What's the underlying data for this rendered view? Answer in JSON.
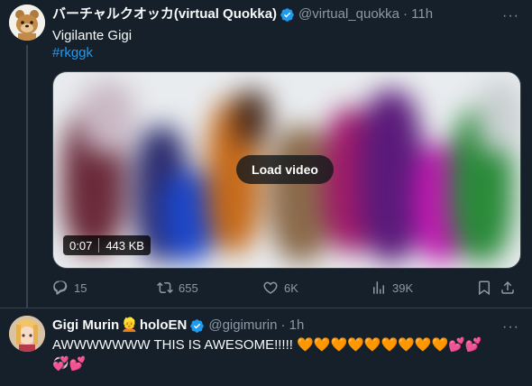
{
  "tweet1": {
    "display_name": "バーチャルクオッカ(virtual Quokka)",
    "handle": "@virtual_quokka",
    "time": "· 11h",
    "text": "Vigilante Gigi",
    "hashtag": "#rkggk",
    "video": {
      "load_label": "Load video",
      "duration": "0:07",
      "size": "443 KB"
    },
    "actions": {
      "replies": "15",
      "reposts": "655",
      "likes": "6K",
      "views": "39K"
    }
  },
  "tweet2": {
    "display_name": "Gigi Murin",
    "name_emoji": "👱",
    "name_suffix": "holoEN",
    "handle": "@gigimurin",
    "time": "· 1h",
    "text_line1": "AWWWWWWW THIS IS AWESOME!!!!! 🧡🧡🧡🧡🧡🧡🧡🧡🧡💕💕",
    "text_line2": "💞💕"
  },
  "colors": {
    "background": "#15202b",
    "accent": "#1d9bf0",
    "secondary_text": "#8b98a5",
    "divider": "#38444d"
  },
  "icons": [
    "reply-icon",
    "repost-icon",
    "like-icon",
    "views-icon",
    "bookmark-icon",
    "share-icon",
    "verified-badge-icon",
    "more-icon"
  ]
}
